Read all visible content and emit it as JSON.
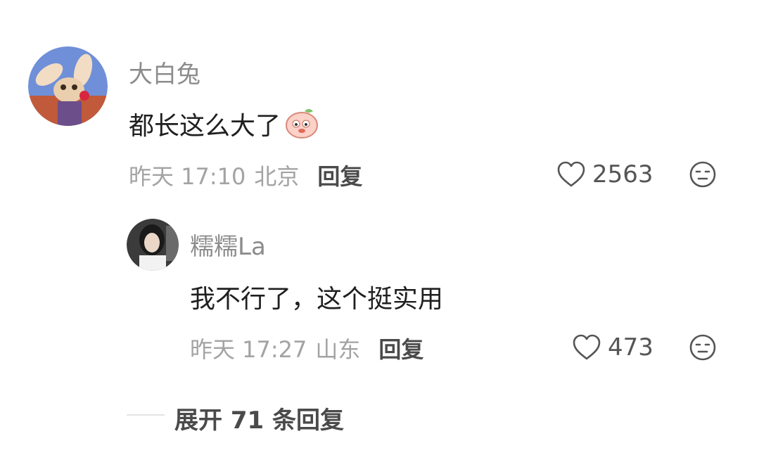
{
  "comments": [
    {
      "user": "大白兔",
      "text": "都长这么大了",
      "time": "昨天 17:10",
      "location": "北京",
      "reply_label": "回复",
      "likes": "2563"
    }
  ],
  "reply": {
    "user": "糯糯La",
    "text": "我不行了，这个挺实用",
    "time": "昨天 17:27",
    "location": "山东",
    "reply_label": "回复",
    "likes": "473"
  },
  "expand_label": "展开 71 条回复",
  "colors": {
    "meta": "#a3a3a3",
    "name": "#8c8c8c",
    "text": "#1f1f1f"
  }
}
